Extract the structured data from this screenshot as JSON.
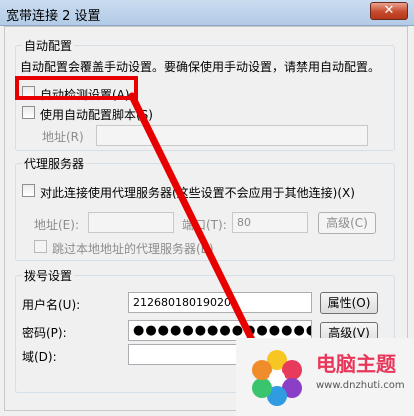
{
  "window": {
    "title": "宽带连接 2 设置",
    "close_label": "✕"
  },
  "auto_config": {
    "group_label": "自动配置",
    "description": "自动配置会覆盖手动设置。要确保使用手动设置，请禁用自动配置。",
    "detect_label": "自动检测设置(A)",
    "detect_checked": false,
    "script_label": "使用自动配置脚本(S)",
    "script_checked": false,
    "address_label": "地址(R)",
    "address_value": ""
  },
  "proxy": {
    "group_label": "代理服务器",
    "use_proxy_label": "对此连接使用代理服务器(这些设置不会应用于其他连接)(X)",
    "use_proxy_checked": false,
    "address_label": "地址(E):",
    "address_value": "",
    "port_label": "端口(T):",
    "port_value": "80",
    "advanced_label": "高级(C)",
    "bypass_label": "跳过本地地址的代理服务器(B)",
    "bypass_checked": false
  },
  "dialup": {
    "group_label": "拨号设置",
    "username_label": "用户名(U):",
    "username_value": "212680180190201",
    "properties_label": "属性(O)",
    "password_label": "密码(P):",
    "password_value": "●●●●●●●●●●●●●●●●●●●",
    "advanced_label": "高级(V)",
    "domain_label": "域(D):",
    "domain_value": ""
  },
  "watermark": {
    "text": "电脑主题",
    "url": "www.dnzhuti.com"
  },
  "colors": {
    "highlight": "#e80000",
    "arrow": "#e80000",
    "watermark_text": "#e8375a"
  }
}
